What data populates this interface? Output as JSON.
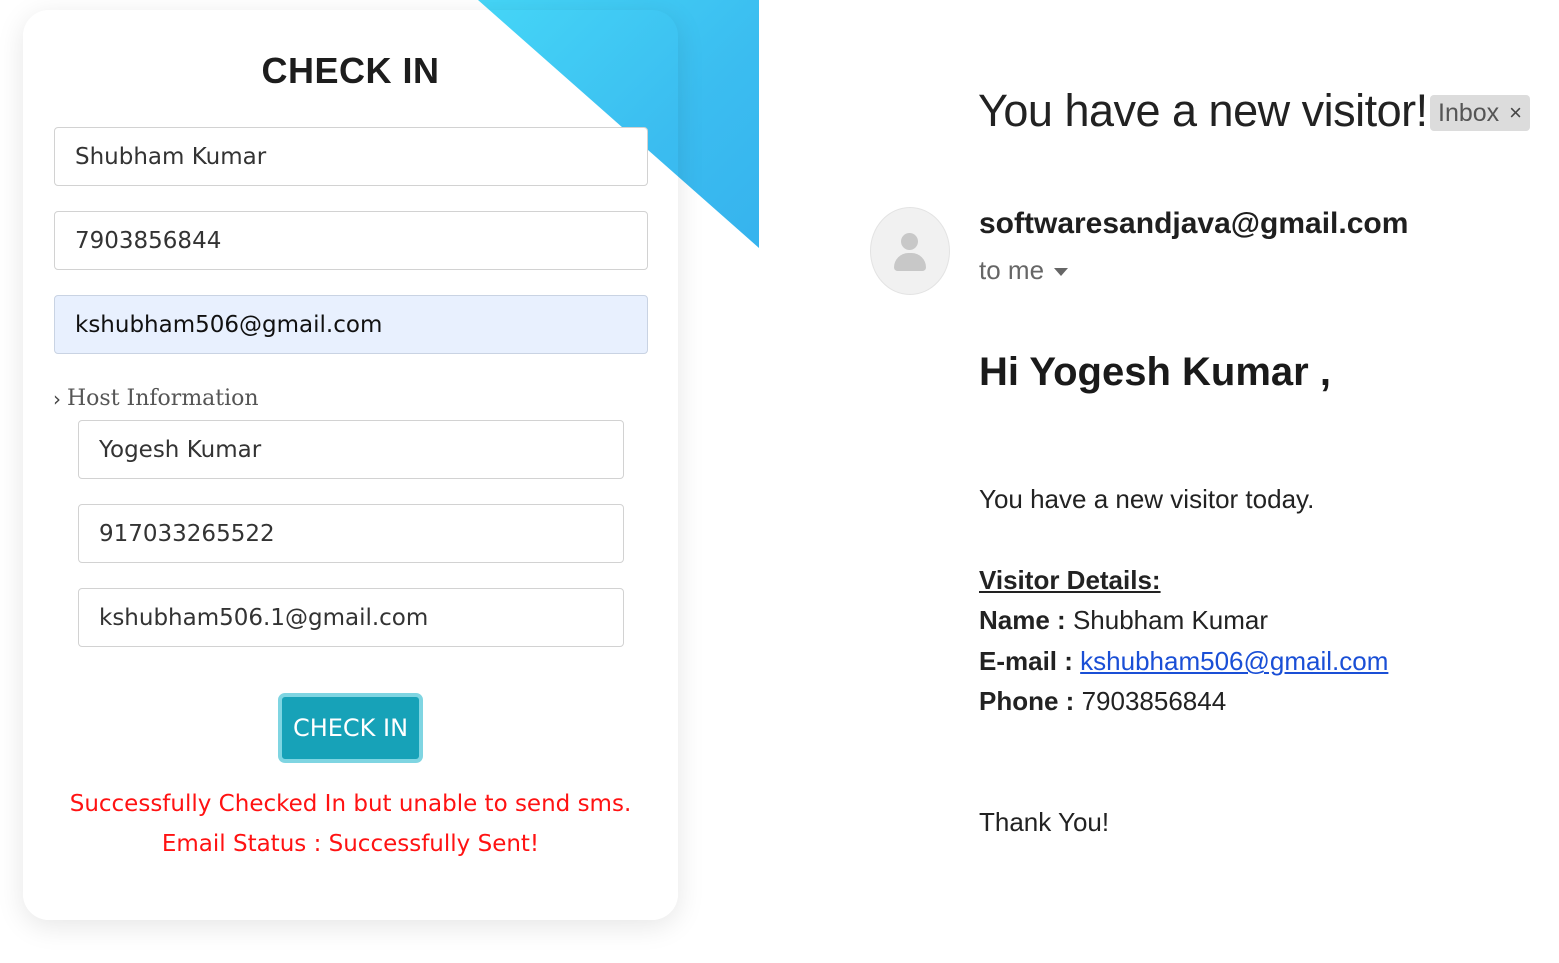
{
  "checkin_form": {
    "title": "CHECK IN",
    "visitor": {
      "name": "Shubham Kumar",
      "phone": "7903856844",
      "email": "kshubham506@gmail.com"
    },
    "host_section_label": "Host Information",
    "host": {
      "name": "Yogesh Kumar",
      "phone": "917033265522",
      "email": "kshubham506.1@gmail.com"
    },
    "submit_label": "CHECK IN",
    "status_sms": "Successfully Checked In but unable to send sms.",
    "status_email": "Email Status : Successfully Sent!",
    "colors": {
      "accent_button": "#17a2b8",
      "status_text": "#ff1212",
      "corner_gradient": "#3bbdf0"
    }
  },
  "email_view": {
    "subject": "You have a new visitor!",
    "label_chip": "Inbox",
    "label_chip_close": "×",
    "sender": "softwaresandjava@gmail.com",
    "recipient": "to me",
    "greeting": "Hi Yogesh Kumar ,",
    "intro": "You have a new visitor today.",
    "details_heading": "Visitor Details:",
    "details": {
      "name_label": "Name :",
      "name_value": "Shubham Kumar",
      "email_label": "E-mail :",
      "email_value": "kshubham506@gmail.com",
      "phone_label": "Phone :",
      "phone_value": "7903856844"
    },
    "signoff": "Thank You!"
  }
}
